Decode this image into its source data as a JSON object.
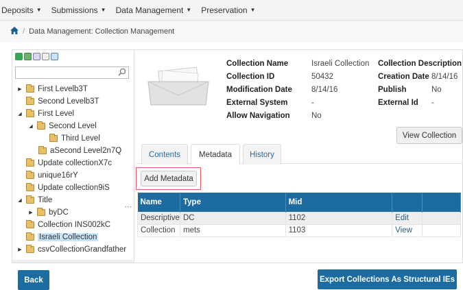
{
  "topnav": {
    "menus": [
      "Deposits",
      "Submissions",
      "Data Management",
      "Preservation"
    ]
  },
  "breadcrumb": {
    "text": "Data Management: Collection Management"
  },
  "tree": {
    "nodes": [
      {
        "label": "First Levelb3T",
        "toggle": "collapsed"
      },
      {
        "label": "Second Levelb3T",
        "toggle": "none"
      },
      {
        "label": "First Level",
        "toggle": "expanded"
      },
      {
        "label": "Second Level",
        "toggle": "expanded"
      },
      {
        "label": "Third Level",
        "toggle": "none"
      },
      {
        "label": "aSecond Level2n7Q",
        "toggle": "none"
      },
      {
        "label": "Update collectionX7c",
        "toggle": "none"
      },
      {
        "label": "unique16rY",
        "toggle": "none"
      },
      {
        "label": "Update collection9iS",
        "toggle": "none"
      },
      {
        "label": "Title",
        "toggle": "expanded"
      },
      {
        "label": "byDC",
        "toggle": "collapsed"
      },
      {
        "label": "Collection INS002kC",
        "toggle": "none"
      },
      {
        "label": "Israeli Collection",
        "toggle": "none",
        "selected": true
      },
      {
        "label": "csvCollectionGrandfather",
        "toggle": "collapsed"
      }
    ]
  },
  "details": {
    "collection_name_label": "Collection Name",
    "collection_name": "Israeli Collection",
    "collection_id_label": "Collection ID",
    "collection_id": "50432",
    "modification_date_label": "Modification Date",
    "modification_date": "8/14/16",
    "external_system_label": "External System",
    "external_system": "-",
    "allow_navigation_label": "Allow Navigation",
    "allow_navigation": "No",
    "collection_description_label": "Collection Description",
    "creation_date_label": "Creation Date",
    "creation_date": "8/14/16",
    "publish_label": "Publish",
    "publish": "No",
    "external_id_label": "External Id",
    "external_id": "-"
  },
  "buttons": {
    "view_collection": "View Collection",
    "add_metadata": "Add Metadata",
    "back": "Back",
    "export": "Export Collections As Structural IEs"
  },
  "tabs": [
    "Contents",
    "Metadata",
    "History"
  ],
  "active_tab": "Metadata",
  "table": {
    "headers": [
      "Name",
      "Type",
      "Mid",
      "",
      ""
    ],
    "rows": [
      {
        "name": "Descriptive",
        "type": "DC",
        "mid": "1102",
        "action": "Edit"
      },
      {
        "name": "Collection",
        "type": "mets",
        "mid": "1103",
        "action": "View"
      }
    ]
  },
  "colors": {
    "header_blue": "#1d6ca1",
    "link_blue": "#1d5f91",
    "highlight_border": "#e0585a",
    "selected_node": "#c8e4f8"
  }
}
